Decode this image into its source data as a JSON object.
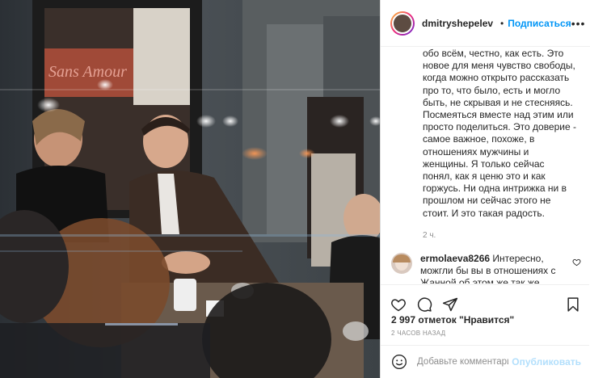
{
  "post": {
    "photo_description_icon": "photo",
    "username": "dmitryshepelev",
    "verified_icon": "verified-badge-icon",
    "dot": "•",
    "follow_label": "Подписаться",
    "more_label": "•••",
    "caption_text": "обо всём, честно, как есть. Это новое для меня чувство свободы, когда можно открыто рассказать про то, что было, есть и могло быть, не скрывая и не стесняясь. Посмеяться вместе над этим или просто поделиться. Это доверие - самое важное, похоже, в отношениях мужчины и женщины. Я только сейчас понял, как я ценю это и как горжусь. Ни одна интрижка ни в прошлом ни сейчас этого не стоит. И это такая радость.",
    "caption_time": "2 ч.",
    "comments": [
      {
        "user": "ermolaeva8266",
        "text": "Интересно, можгли бы вы в отношениях с Жанной об этом же так же сказать? Имею ввиду доверие"
      }
    ],
    "likes": "2 997 отметок \"Нравится\"",
    "date": "2 ЧАСОВ НАЗАД",
    "comment_placeholder": "Добавьте комментарий...",
    "publish_label": "Опубликовать"
  },
  "colors": {
    "accent": "#0095f6",
    "publish_disabled": "#b2dffc",
    "text": "#262626",
    "muted": "#8e8e8e"
  }
}
